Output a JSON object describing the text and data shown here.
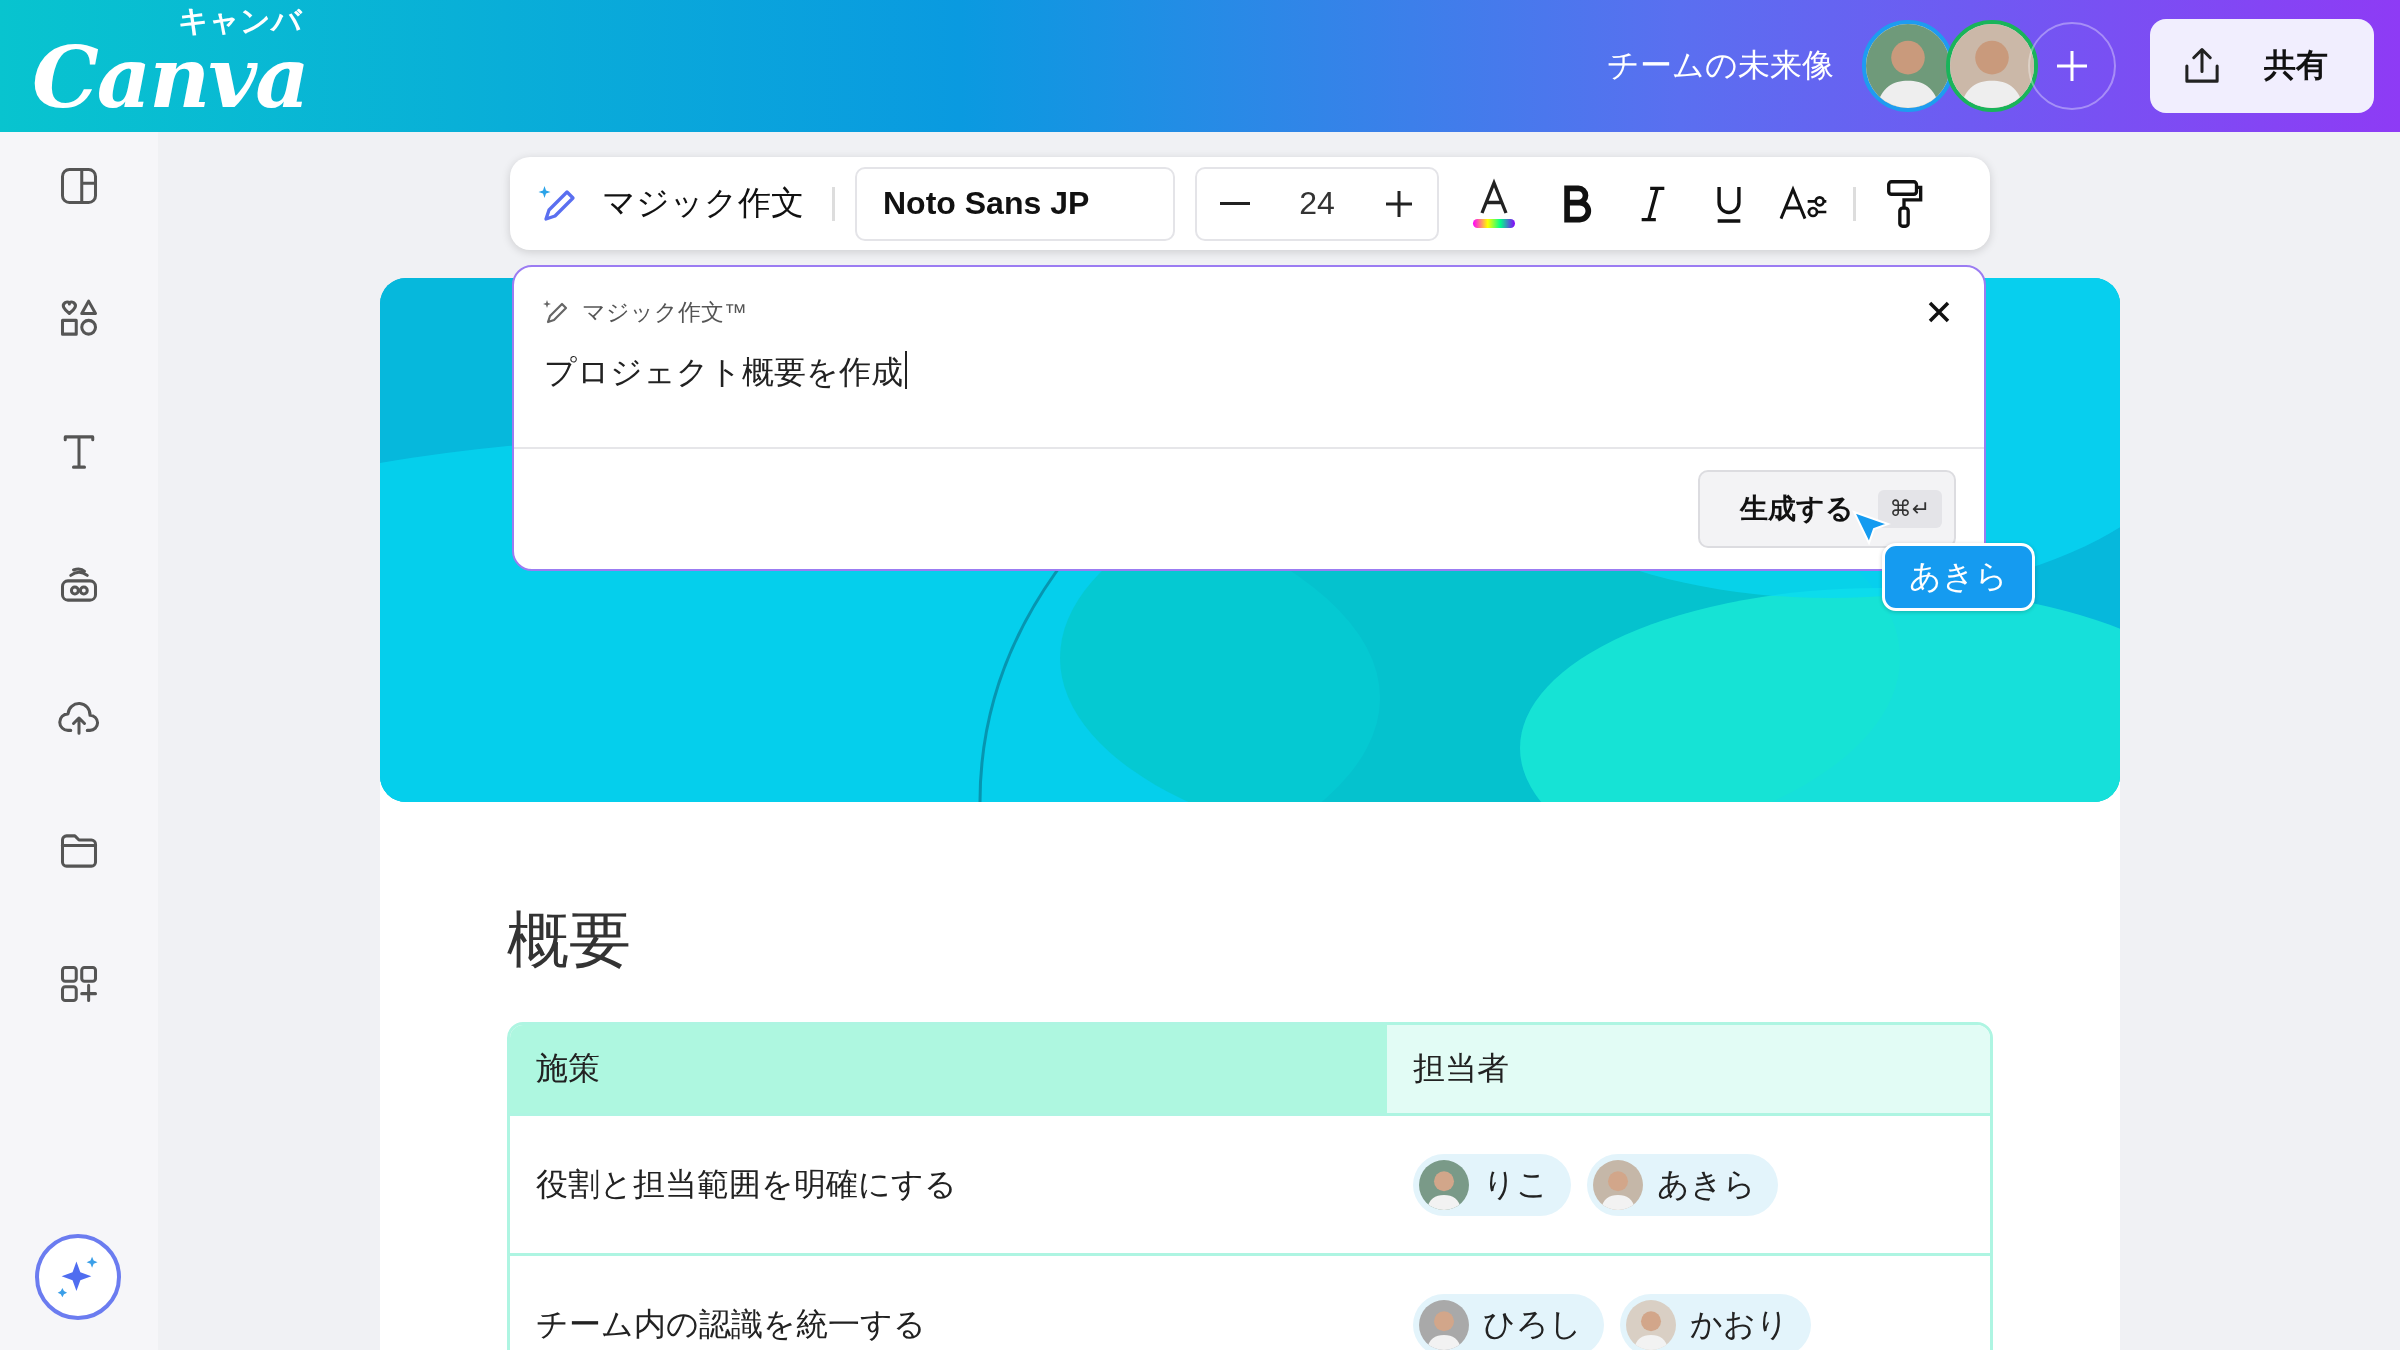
{
  "header": {
    "logo": "Canva",
    "logo_kana": "キャンバ",
    "team_name": "チームの未来像",
    "share_label": "共有"
  },
  "toolbar": {
    "magic_write_label": "マジック作文",
    "font": "Noto Sans JP",
    "font_size": "24"
  },
  "magic_write": {
    "title": "マジック作文™",
    "prompt": "プロジェクト概要を作成",
    "generate_label": "生成する",
    "shortcut": "⌘↵"
  },
  "cursor_label": "あきら",
  "document": {
    "heading": "概要",
    "table": {
      "columns": [
        {
          "label": "施策",
          "selected": true
        },
        {
          "label": "担当者",
          "selected": false
        }
      ],
      "rows": [
        {
          "measure": "役割と担当範囲を明確にする",
          "assignees": [
            {
              "name": "りこ"
            },
            {
              "name": "あきら"
            }
          ]
        },
        {
          "measure": "チーム内の認識を統一する",
          "assignees": [
            {
              "name": "ひろし"
            },
            {
              "name": "かおり"
            }
          ]
        }
      ]
    }
  }
}
